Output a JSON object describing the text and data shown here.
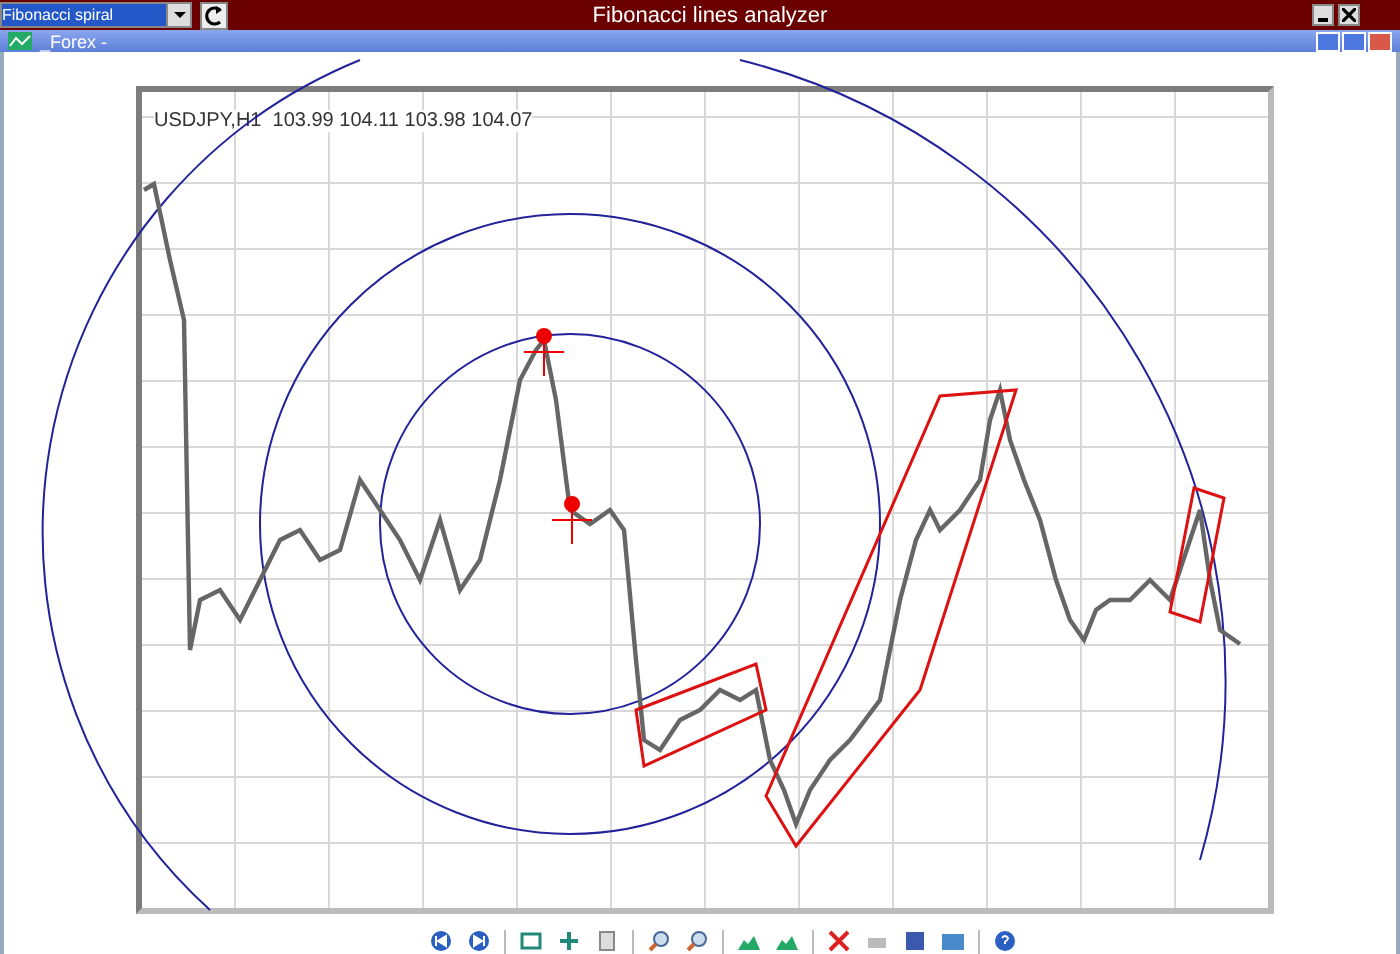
{
  "app_bar": {
    "tool_select": {
      "value": "Fibonacci spiral"
    },
    "title": "Fibonacci lines analyzer"
  },
  "chart_window": {
    "title": "_Forex -",
    "chart_header": "USDJPY,H1  103.99 104.11 103.98 104.07"
  }
}
